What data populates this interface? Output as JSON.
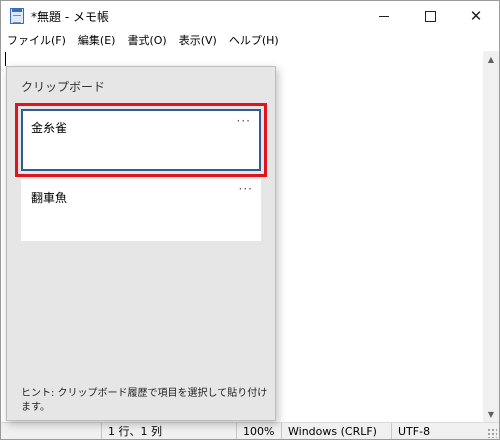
{
  "window": {
    "title": "*無題 - メモ帳",
    "controls": {
      "minimize": "minimize",
      "maximize": "maximize",
      "close": "close"
    }
  },
  "menu": [
    {
      "label": "ファイル(F)"
    },
    {
      "label": "編集(E)"
    },
    {
      "label": "書式(O)"
    },
    {
      "label": "表示(V)"
    },
    {
      "label": "ヘルプ(H)"
    }
  ],
  "editor": {
    "content": ""
  },
  "clipboard": {
    "title": "クリップボード",
    "items": [
      {
        "text": "金糸雀",
        "more": "···",
        "selected": true
      },
      {
        "text": "翻車魚",
        "more": "···",
        "selected": false
      }
    ],
    "hint": "ヒント: クリップボード履歴で項目を選択して貼り付けます。"
  },
  "status": {
    "position": "1 行、1 列",
    "zoom": "100%",
    "line_ending": "Windows (CRLF)",
    "encoding": "UTF-8"
  },
  "colors": {
    "highlight": "#e0141e",
    "selection_border": "#2e5d90",
    "panel_bg": "#e6e6e6"
  }
}
